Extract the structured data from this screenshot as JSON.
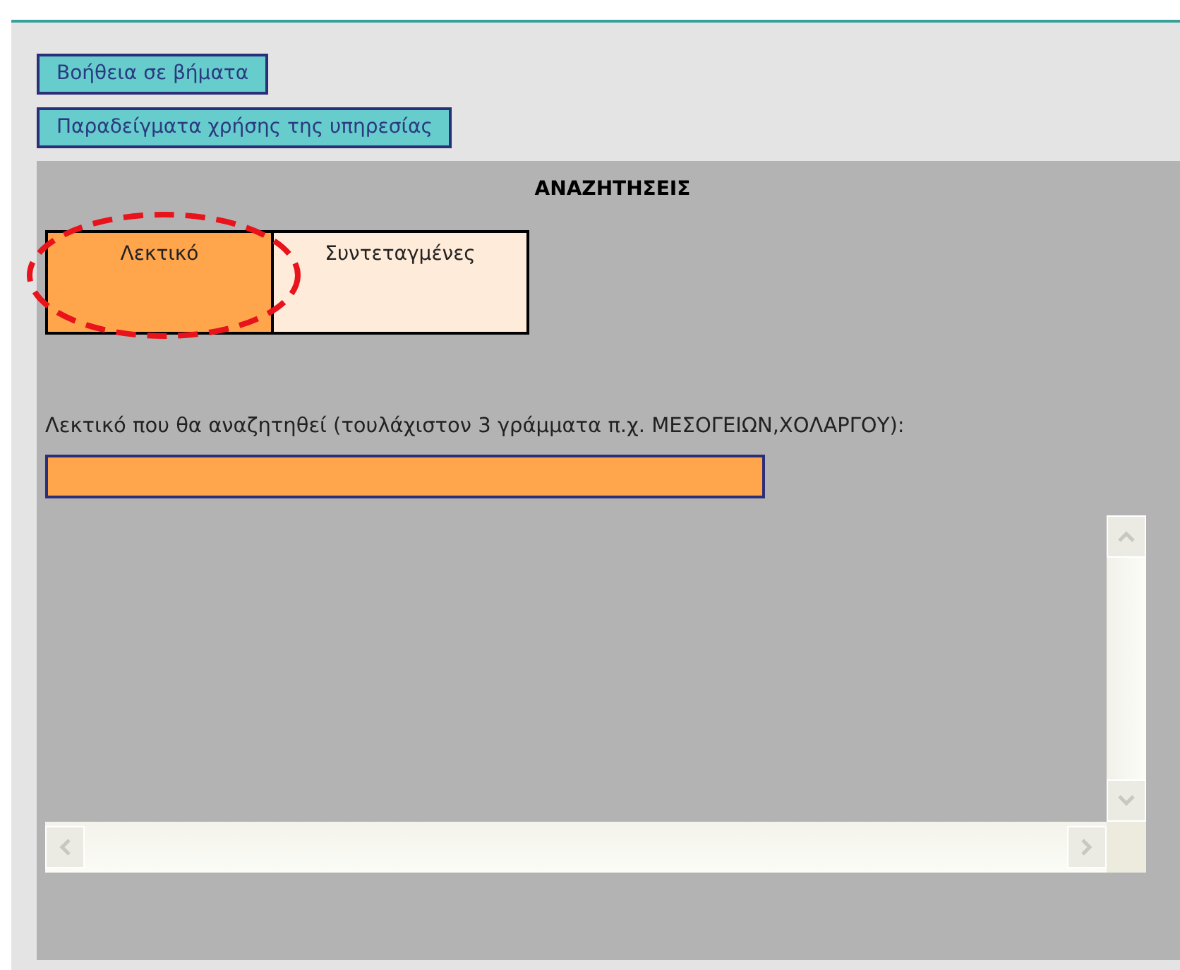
{
  "help_buttons": [
    "Βοήθεια σε βήματα",
    "Παραδείγματα χρήσης της υπηρεσίας"
  ],
  "search_panel": {
    "title": "ΑΝΑΖΗΤΗΣΕΙΣ",
    "tabs": [
      {
        "label": "Λεκτικό",
        "selected": true,
        "circled": true
      },
      {
        "label": "Συντεταγμένες",
        "selected": false,
        "circled": false
      }
    ],
    "field_label": "Λεκτικό που θα αναζητηθεί (τουλάχιστον 3 γράμματα π.χ. ΜΕΣΟΓΕΙΩΝ,ΧΟΛΑΡΓΟΥ):"
  }
}
